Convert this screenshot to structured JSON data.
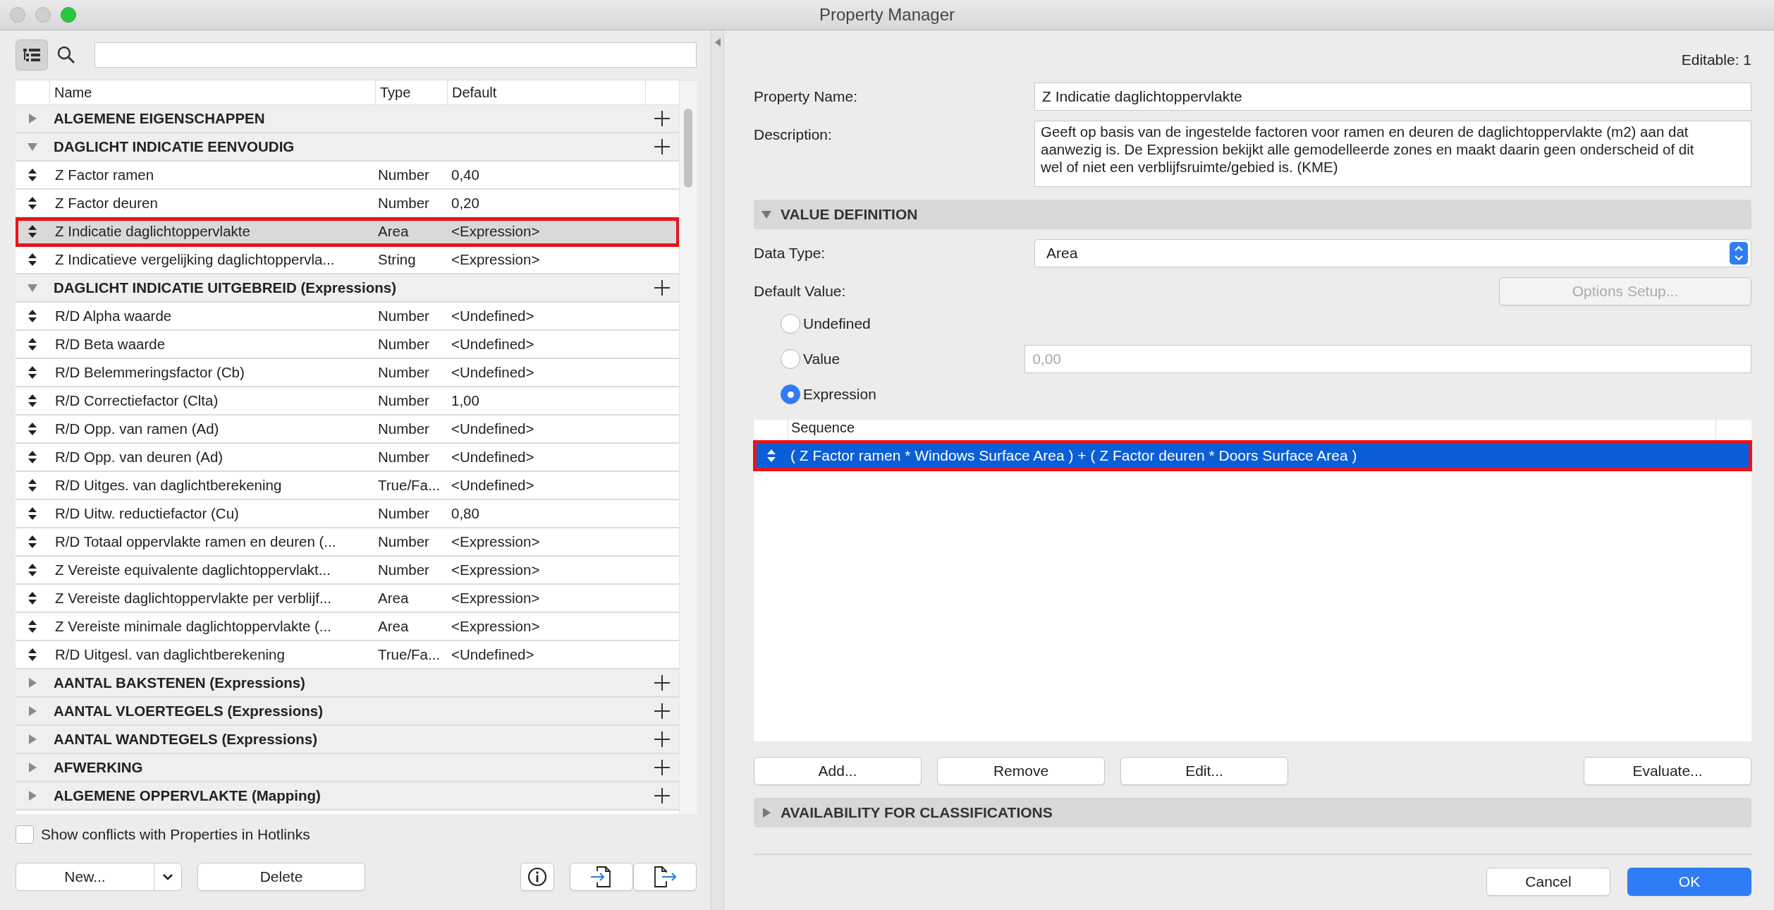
{
  "window": {
    "title": "Property Manager"
  },
  "tree": {
    "columns": [
      "Name",
      "Type",
      "Default"
    ],
    "groups": [
      {
        "name": "ALGEMENE EIGENSCHAPPEN",
        "expanded": false
      },
      {
        "name": "DAGLICHT INDICATIE EENVOUDIG",
        "expanded": true,
        "children": [
          {
            "name": "Z Factor ramen",
            "type": "Number",
            "default": "0,40",
            "selected": false,
            "highlighted": false
          },
          {
            "name": "Z Factor deuren",
            "type": "Number",
            "default": "0,20",
            "selected": false,
            "highlighted": false
          },
          {
            "name": "Z Indicatie daglichtoppervlakte",
            "type": "Area",
            "default": "<Expression>",
            "selected": true,
            "highlighted": true
          },
          {
            "name": "Z Indicatieve vergelijking daglichtoppervla...",
            "type": "String",
            "default": "<Expression>",
            "selected": false,
            "highlighted": false
          }
        ]
      },
      {
        "name": "DAGLICHT INDICATIE UITGEBREID (Expressions)",
        "expanded": true,
        "children": [
          {
            "name": "R/D Alpha waarde",
            "type": "Number",
            "default": "<Undefined>",
            "selected": false,
            "highlighted": false
          },
          {
            "name": "R/D Beta waarde",
            "type": "Number",
            "default": "<Undefined>",
            "selected": false,
            "highlighted": false
          },
          {
            "name": "R/D Belemmeringsfactor (Cb)",
            "type": "Number",
            "default": "<Undefined>",
            "selected": false,
            "highlighted": false
          },
          {
            "name": "R/D Correctiefactor (Clta)",
            "type": "Number",
            "default": "1,00",
            "selected": false,
            "highlighted": false
          },
          {
            "name": "R/D Opp. van ramen (Ad)",
            "type": "Number",
            "default": "<Undefined>",
            "selected": false,
            "highlighted": false
          },
          {
            "name": "R/D Opp. van deuren (Ad)",
            "type": "Number",
            "default": "<Undefined>",
            "selected": false,
            "highlighted": false
          },
          {
            "name": "R/D Uitges. van daglichtberekening",
            "type": "True/Fa...",
            "default": "<Undefined>",
            "selected": false,
            "highlighted": false
          },
          {
            "name": "R/D Uitw. reductiefactor (Cu)",
            "type": "Number",
            "default": "0,80",
            "selected": false,
            "highlighted": false
          },
          {
            "name": "R/D Totaal oppervlakte ramen en deuren (...",
            "type": "Number",
            "default": "<Expression>",
            "selected": false,
            "highlighted": false
          },
          {
            "name": "Z Vereiste equivalente daglichtoppervlakt...",
            "type": "Number",
            "default": "<Expression>",
            "selected": false,
            "highlighted": false
          },
          {
            "name": "Z Vereiste daglichtoppervlakte per verblijf...",
            "type": "Area",
            "default": "<Expression>",
            "selected": false,
            "highlighted": false
          },
          {
            "name": "Z Vereiste minimale daglichtoppervlakte (...",
            "type": "Area",
            "default": "<Expression>",
            "selected": false,
            "highlighted": false
          },
          {
            "name": "R/D Uitgesl. van daglichtberekening",
            "type": "True/Fa...",
            "default": "<Undefined>",
            "selected": false,
            "highlighted": false
          }
        ]
      },
      {
        "name": "AANTAL BAKSTENEN (Expressions)",
        "expanded": false
      },
      {
        "name": "AANTAL VLOERTEGELS (Expressions)",
        "expanded": false
      },
      {
        "name": "AANTAL WANDTEGELS (Expressions)",
        "expanded": false
      },
      {
        "name": "AFWERKING",
        "expanded": false
      },
      {
        "name": "ALGEMENE OPPERVLAKTE (Mapping)",
        "expanded": false
      }
    ]
  },
  "show_conflicts": {
    "label": "Show conflicts with Properties in Hotlinks",
    "checked": false
  },
  "left_buttons": {
    "new": "New...",
    "delete": "Delete"
  },
  "editable": "Editable: 1",
  "property_name": {
    "label": "Property Name:",
    "value": "Z Indicatie daglichtoppervlakte"
  },
  "description": {
    "label": "Description:",
    "value": "Geeft op basis van de ingestelde factoren voor ramen en deuren de daglichtoppervlakte (m2) aan dat aanwezig is. De Expression bekijkt alle gemodelleerde zones en maakt daarin geen onderscheid of dit wel of niet een verblijfsruimte/gebied is. (KME)"
  },
  "value_definition": {
    "title": "VALUE DEFINITION",
    "expanded": true
  },
  "data_type": {
    "label": "Data Type:",
    "value": "Area"
  },
  "default_value": {
    "label": "Default Value:",
    "options_button": {
      "label": "Options Setup...",
      "disabled": true
    },
    "options": [
      {
        "label": "Undefined",
        "selected": false,
        "kind": "plain"
      },
      {
        "label": "Value",
        "selected": false,
        "kind": "field",
        "field_value": "0,00",
        "field_disabled": true
      },
      {
        "label": "Expression",
        "selected": true,
        "kind": "plain"
      }
    ]
  },
  "sequence": {
    "column": "Sequence",
    "rows": [
      {
        "text": "( Z Factor ramen * Windows Surface Area ) + ( Z Factor deuren * Doors Surface Area )",
        "selected": true,
        "highlighted": true
      }
    ]
  },
  "sequence_buttons": [
    "Add...",
    "Remove",
    "Edit..."
  ],
  "evaluate_button": "Evaluate...",
  "availability": {
    "title": "AVAILABILITY FOR CLASSIFICATIONS",
    "expanded": false
  },
  "footer": {
    "cancel": "Cancel",
    "ok": "OK"
  }
}
